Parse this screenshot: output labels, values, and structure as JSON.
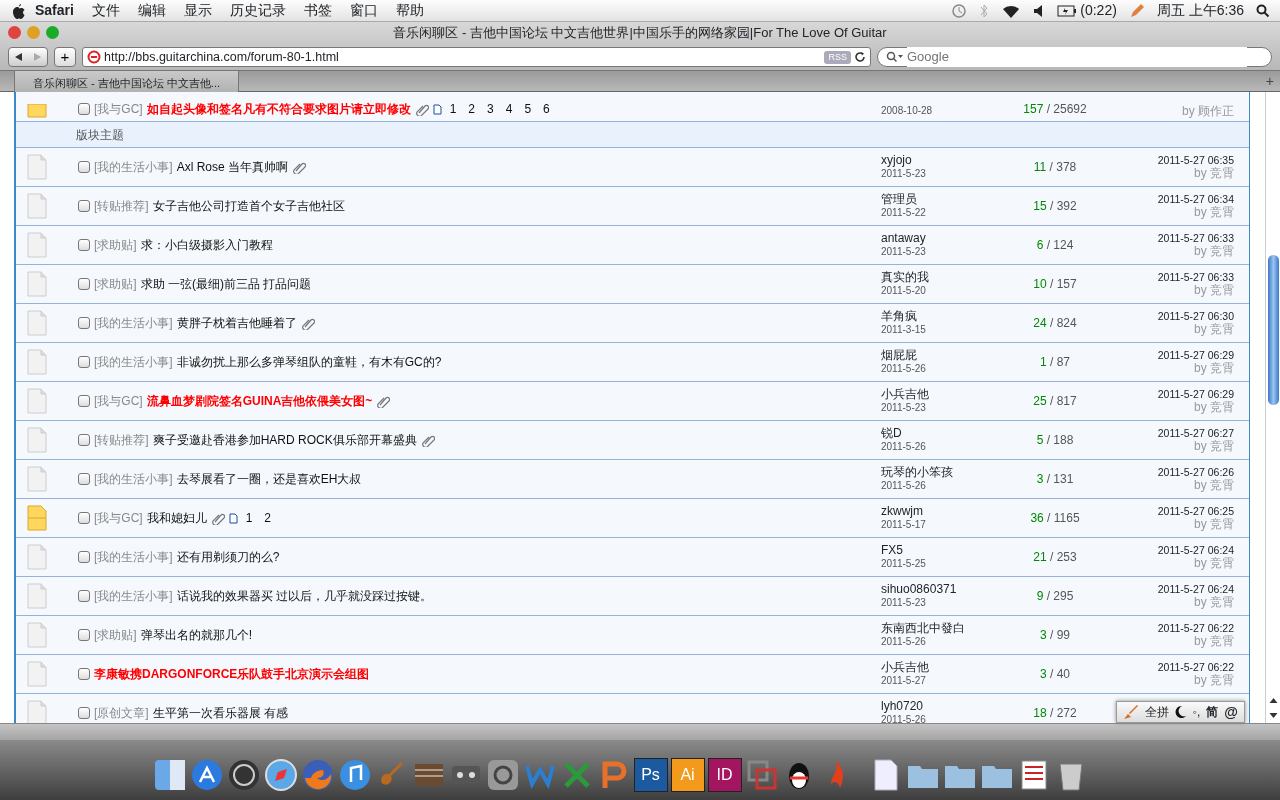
{
  "menu_bar": {
    "app": "Safari",
    "items": [
      "文件",
      "编辑",
      "显示",
      "历史记录",
      "书签",
      "窗口",
      "帮助"
    ],
    "battery": "(0:22)",
    "clock": "周五 上午6:36"
  },
  "window": {
    "title": "音乐闲聊区 - 吉他中国论坛 中文吉他世界|中国乐手的网络家园|For The Love Of Guitar"
  },
  "toolbar": {
    "add": "+",
    "url": "http://bbs.guitarchina.com/forum-80-1.html",
    "rss": "RSS",
    "search": {
      "placeholder": "Google"
    }
  },
  "tabs": [
    {
      "label": "音乐闲聊区 - 吉他中国论坛 中文吉他...",
      "selected": true
    }
  ],
  "new_tab": "+",
  "pinned_row": {
    "tag": "[我与GC]",
    "title": "如自起头像和签名凡有不符合要求图片请立即修改",
    "pages": [
      "1",
      "2",
      "3",
      "4",
      "5",
      "6"
    ],
    "checked": false,
    "date": "2008-10-28",
    "replies": "157",
    "views": "/ 25692",
    "last_by": "by 顾作正"
  },
  "section": "版块主题",
  "rows": [
    {
      "kind": "plain",
      "tag": "[我的生活小事]",
      "title": "Axl Rose 当年真帅啊",
      "highlight": false,
      "attachment": true,
      "checked": false,
      "author": "xyjojo",
      "date": "2011-5-23",
      "replies": "11",
      "views": "/ 378",
      "last_time": "2011-5-27 06:35",
      "last_by": "by 竞霄"
    },
    {
      "kind": "plain",
      "tag": "[转贴推荐]",
      "title": "女子吉他公司打造首个女子吉他社区",
      "highlight": false,
      "attachment": false,
      "checked": false,
      "author": "管理员",
      "date": "2011-5-22",
      "replies": "15",
      "views": "/ 392",
      "last_time": "2011-5-27 06:34",
      "last_by": "by 竞霄"
    },
    {
      "kind": "plain",
      "tag": "[求助贴]",
      "title": "求：小白级摄影入门教程",
      "highlight": false,
      "attachment": false,
      "checked": false,
      "author": "antaway",
      "date": "2011-5-23",
      "replies": "6",
      "views": "/ 124",
      "last_time": "2011-5-27 06:33",
      "last_by": "by 竞霄"
    },
    {
      "kind": "plain",
      "tag": "[求助贴]",
      "title": "求助 一弦(最细)前三品 打品问题",
      "highlight": false,
      "attachment": false,
      "checked": false,
      "author": "真实的我",
      "date": "2011-5-20",
      "replies": "10",
      "views": "/ 157",
      "last_time": "2011-5-27 06:33",
      "last_by": "by 竞霄"
    },
    {
      "kind": "plain",
      "tag": "[我的生活小事]",
      "title": "黄胖子枕着吉他睡着了",
      "highlight": false,
      "attachment": true,
      "checked": false,
      "author": "羊角疯",
      "date": "2011-3-15",
      "replies": "24",
      "views": "/ 824",
      "last_time": "2011-5-27 06:30",
      "last_by": "by 竞霄"
    },
    {
      "kind": "plain",
      "tag": "[我的生活小事]",
      "title": "非诚勿扰上那么多弹琴组队的童鞋，有木有GC的?",
      "highlight": false,
      "attachment": false,
      "checked": false,
      "author": "烟屁屁",
      "date": "2011-5-26",
      "replies": "1",
      "views": "/ 87",
      "last_time": "2011-5-27 06:29",
      "last_by": "by 竞霄"
    },
    {
      "kind": "plain",
      "tag": "[我与GC]",
      "title": "流鼻血梦剧院签名GUINA吉他依偎美女图~",
      "highlight": true,
      "attachment": true,
      "checked": false,
      "author": "小兵吉他",
      "date": "2011-5-23",
      "replies": "25",
      "views": "/ 817",
      "last_time": "2011-5-27 06:29",
      "last_by": "by 竞霄"
    },
    {
      "kind": "plain",
      "tag": "[转贴推荐]",
      "title": "爽子受邀赴香港参加HARD ROCK俱乐部开幕盛典",
      "highlight": false,
      "attachment": true,
      "checked": false,
      "author": "锐D",
      "date": "2011-5-26",
      "replies": "5",
      "views": "/ 188",
      "last_time": "2011-5-27 06:27",
      "last_by": "by 竞霄"
    },
    {
      "kind": "plain",
      "tag": "[我的生活小事]",
      "title": "去琴展看了一圈，还是喜欢EH大叔",
      "highlight": false,
      "attachment": false,
      "checked": false,
      "author": "玩琴的小笨孩",
      "date": "2011-5-26",
      "replies": "3",
      "views": "/ 131",
      "last_time": "2011-5-27 06:26",
      "last_by": "by 竞霄"
    },
    {
      "kind": "hot",
      "tag": "[我与GC]",
      "title": "我和媳妇儿",
      "highlight": false,
      "attachment": true,
      "pages": [
        "1",
        "2"
      ],
      "checked": false,
      "author": "zkwwjm",
      "date": "2011-5-17",
      "replies": "36",
      "views": "/ 1165",
      "last_time": "2011-5-27 06:25",
      "last_by": "by 竞霄"
    },
    {
      "kind": "plain",
      "tag": "[我的生活小事]",
      "title": "还有用剃须刀的么?",
      "highlight": false,
      "attachment": false,
      "checked": false,
      "author": "FX5",
      "date": "2011-5-25",
      "replies": "21",
      "views": "/ 253",
      "last_time": "2011-5-27 06:24",
      "last_by": "by 竞霄"
    },
    {
      "kind": "plain",
      "tag": "[我的生活小事]",
      "title": "话说我的效果器买 过以后，几乎就没踩过按键。",
      "highlight": false,
      "attachment": false,
      "checked": false,
      "author": "sihuo0860371",
      "date": "2011-5-23",
      "replies": "9",
      "views": "/ 295",
      "last_time": "2011-5-27 06:24",
      "last_by": "by 竞霄"
    },
    {
      "kind": "plain",
      "tag": "[求助贴]",
      "title": "弹琴出名的就那几个!",
      "highlight": false,
      "attachment": false,
      "checked": false,
      "author": "东南西北中發白",
      "date": "2011-5-26",
      "replies": "3",
      "views": "/ 99",
      "last_time": "2011-5-27 06:22",
      "last_by": "by 竞霄"
    },
    {
      "kind": "plain",
      "title": "李康敏携DARGONFORCE乐队鼓手北京演示会组图",
      "highlight": true,
      "attachment": false,
      "checked": false,
      "author": "小兵吉他",
      "date": "2011-5-27",
      "replies": "3",
      "views": "/ 40",
      "last_time": "2011-5-27 06:22",
      "last_by": "by 竞霄"
    },
    {
      "kind": "plain",
      "tag": "[原创文章]",
      "title": "生平第一次看乐器展 有感",
      "highlight": false,
      "attachment": false,
      "checked": false,
      "author": "lyh0720",
      "date": "2011-5-26",
      "replies": "18",
      "views": "/ 272"
    }
  ],
  "ime_bar": {
    "mode": "全拼",
    "punct": "◦,",
    "script": "简",
    "at": "@"
  },
  "dock": [
    {
      "kind": "finder"
    },
    {
      "kind": "appstore"
    },
    {
      "kind": "dashboard"
    },
    {
      "kind": "safari"
    },
    {
      "kind": "firefox"
    },
    {
      "kind": "itunes"
    },
    {
      "kind": "guitar"
    },
    {
      "kind": "five"
    },
    {
      "kind": "audio"
    },
    {
      "kind": "prefs"
    },
    {
      "kind": "word"
    },
    {
      "kind": "excel"
    },
    {
      "kind": "ppt"
    },
    {
      "kind": "letter",
      "label": "Ps",
      "color": "#1b5a9e"
    },
    {
      "kind": "letter",
      "label": "Ai",
      "color": "#f39a1c"
    },
    {
      "kind": "letter",
      "label": "ID",
      "color": "#a3155e"
    },
    {
      "kind": "vm"
    },
    {
      "kind": "qq"
    },
    {
      "kind": "flame"
    },
    {
      "kind": "sep"
    },
    {
      "kind": "doc"
    },
    {
      "kind": "folder"
    },
    {
      "kind": "folder"
    },
    {
      "kind": "folder"
    },
    {
      "kind": "sheet"
    },
    {
      "kind": "trash"
    }
  ]
}
